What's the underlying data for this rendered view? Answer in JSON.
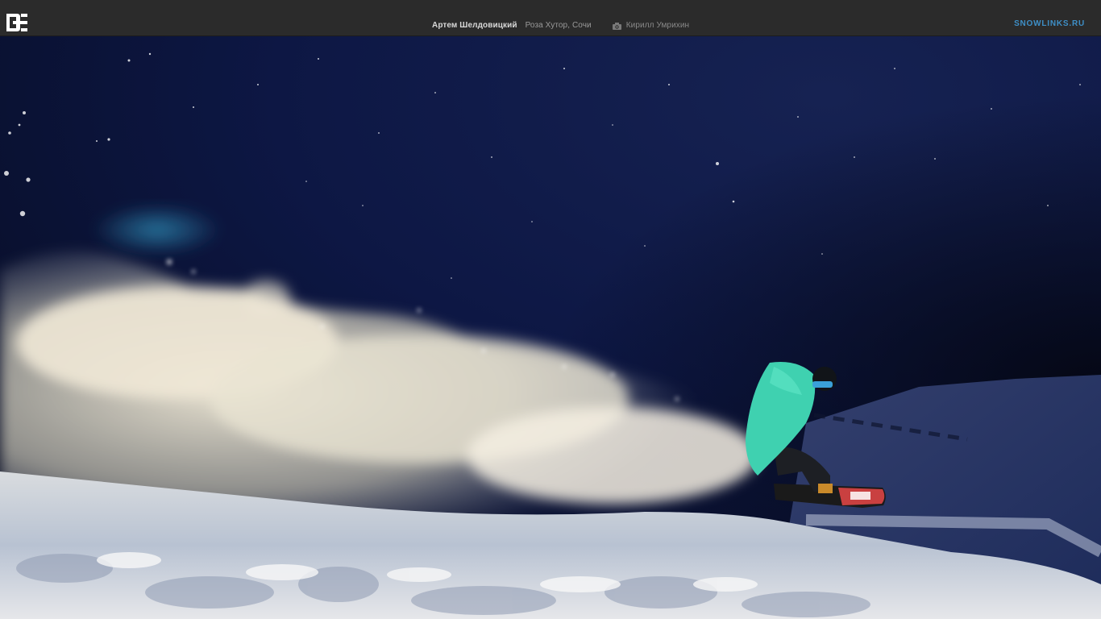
{
  "header": {
    "logo_icon": "dc-logo-icon",
    "rider_name": "Артем Шелдовицкий",
    "location": "Роза Хутор, Сочи",
    "camera_icon": "camera-icon",
    "photographer": "Кирилл Умрихин",
    "brand": "snowlinks.ru"
  },
  "colors": {
    "topbar": "#2b2b2b",
    "sky": "#0b1538",
    "jacket": "#3fd1b0",
    "brand": "#3e8fc7"
  }
}
